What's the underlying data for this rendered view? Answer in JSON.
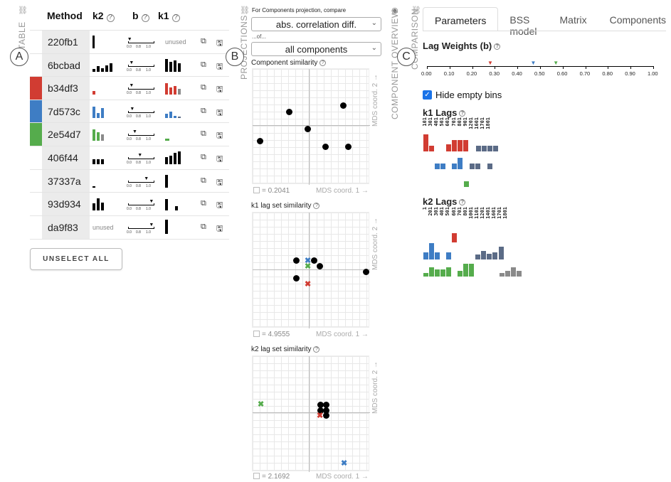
{
  "table": {
    "side_label": "TABLE",
    "circle": "A",
    "headers": {
      "method": "Method",
      "k2": "k2",
      "b": "b",
      "k1": "k1"
    },
    "help_glyph": "?",
    "rows": [
      {
        "id": "220fb1",
        "k1_unused": "unused"
      },
      {
        "id": "6bcbad"
      },
      {
        "id": "b34df3",
        "color": "#d13c32"
      },
      {
        "id": "7d573c",
        "color": "#3e7dc4"
      },
      {
        "id": "2e54d7",
        "color": "#55ac4c"
      },
      {
        "id": "406f44"
      },
      {
        "id": "37337a"
      },
      {
        "id": "93d934"
      },
      {
        "id": "da9f83",
        "k2_unused": "unused"
      }
    ],
    "slider_ticks": [
      "0.0",
      "0.8",
      "1.0"
    ],
    "unselect_label": "UNSELECT ALL"
  },
  "projections": {
    "side_label": "PROJECTIONS",
    "circle": "B",
    "compare_caption": "For Components projection, compare",
    "compare_value": "abs. correlation diff.",
    "of_caption": "...of...",
    "of_value": "all components",
    "plots": [
      {
        "title": "Component similarity",
        "stress": "= 0.2041"
      },
      {
        "title": "k1 lag set similarity",
        "stress": "= 4.9555"
      },
      {
        "title": "k2 lag set similarity",
        "stress": "= 2.1692"
      }
    ],
    "x_axis": "MDS coord. 1 →",
    "y_axis": "MDS coord. 2 →"
  },
  "comparison": {
    "side_label": "COMPARISON",
    "overview_label": "COMPONENT OVERVIEW",
    "circle": "C",
    "tabs": [
      "Parameters",
      "BSS model",
      "Matrix",
      "Components"
    ],
    "active_tab": 0,
    "lag_weights_title": "Lag Weights (b)",
    "axis_ticks": [
      "0.00",
      "0.10",
      "0.20",
      "0.30",
      "0.40",
      "0.50",
      "0.60",
      "0.70",
      "0.80",
      "0.90",
      "1.00"
    ],
    "markers": [
      {
        "value": 0.28,
        "color": "#d13c32"
      },
      {
        "value": 0.47,
        "color": "#3e7dc4"
      },
      {
        "value": 0.57,
        "color": "#55ac4c"
      }
    ],
    "hide_empty_label": "Hide empty bins",
    "hide_empty_checked": true,
    "k1_title": "k1 Lags",
    "k1_cols": [
      "101",
      "301",
      "401",
      "501",
      "601",
      "701",
      "801",
      "901",
      "1201",
      "1601",
      "1701",
      "1801"
    ],
    "k2_title": "k2 Lags",
    "k2_cols": [
      "1",
      "201",
      "301",
      "401",
      "501",
      "601",
      "701",
      "801",
      "1001",
      "1101",
      "1201",
      "1401",
      "1601",
      "1701",
      "1801"
    ]
  },
  "colors": {
    "red": "#d13c32",
    "blue": "#3e7dc4",
    "green": "#55ac4c",
    "gray": "#8a8a8a",
    "slate": "#5b6b86"
  }
}
